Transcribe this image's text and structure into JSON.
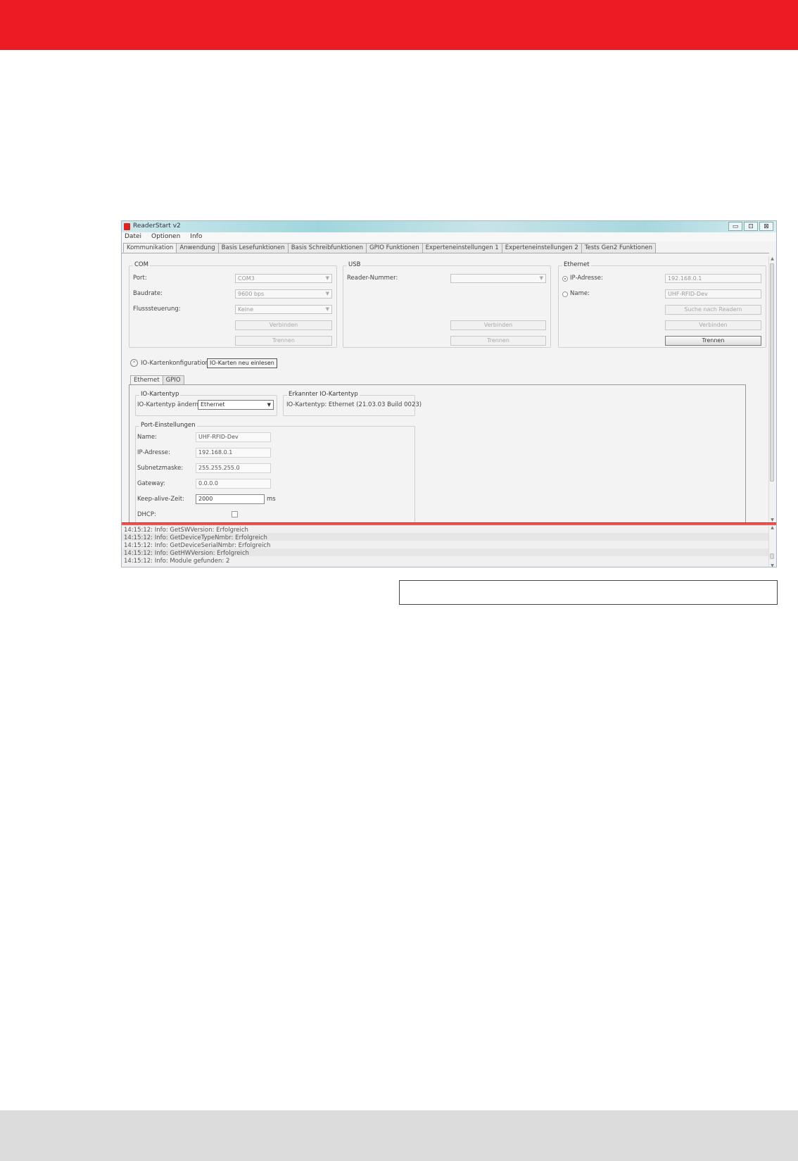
{
  "window": {
    "title": "ReaderStart v2",
    "min": "▭",
    "max": "⊡",
    "close": "⊠"
  },
  "menu": [
    "Datei",
    "Optionen",
    "Info"
  ],
  "tabs": [
    "Kommunikation",
    "Anwendung",
    "Basis Lesefunktionen",
    "Basis Schreibfunktionen",
    "GPIO Funktionen",
    "Experteneinstellungen 1",
    "Experteneinstellungen 2",
    "Tests Gen2 Funktionen"
  ],
  "com": {
    "title": "COM",
    "port_label": "Port:",
    "port_value": "COM3",
    "baud_label": "Baudrate:",
    "baud_value": "9600 bps",
    "flow_label": "Flusssteuerung:",
    "flow_value": "Keine",
    "connect": "Verbinden",
    "disconnect": "Trennen"
  },
  "usb": {
    "title": "USB",
    "reader_label": "Reader-Nummer:",
    "reader_value": "",
    "connect": "Verbinden",
    "disconnect": "Trennen"
  },
  "ethernet": {
    "title": "Ethernet",
    "ip_label": "IP-Adresse:",
    "ip_value": "192.168.0.1",
    "name_label": "Name:",
    "name_value": "UHF-RFID-Dev",
    "search": "Suche nach Readern",
    "connect": "Verbinden",
    "disconnect": "Trennen"
  },
  "io": {
    "collapse_label": "IO-Kartenkonfiguration",
    "button": "IO-Karten neu einlesen",
    "subtabs": [
      "Ethernet",
      "GPIO"
    ],
    "type_group": "IO-Kartentyp",
    "type_change_label": "IO-Kartentyp ändern:",
    "type_value": "Ethernet",
    "detected_group": "Erkannter IO-Kartentyp",
    "detected_text": "IO-Kartentyp: Ethernet (21.03.03 Build 0023)",
    "port_group": "Port-Einstellungen",
    "fields": [
      {
        "label": "Name:",
        "value": "UHF-RFID-Dev"
      },
      {
        "label": "IP-Adresse:",
        "value": "192.168.0.1"
      },
      {
        "label": "Subnetzmaske:",
        "value": "255.255.255.0"
      },
      {
        "label": "Gateway:",
        "value": "0.0.0.0"
      },
      {
        "label": "Keep-alive-Zeit:",
        "value": "2000"
      }
    ],
    "unit_ms": "ms",
    "dhcp_label": "DHCP:"
  },
  "log": [
    "14:15:12: Info: GetSWVersion: Erfolgreich",
    "14:15:12: Info: GetDeviceTypeNmbr: Erfolgreich",
    "14:15:12: Info: GetDeviceSerialNmbr: Erfolgreich",
    "14:15:12: Info: GetHWVersion: Erfolgreich",
    "14:15:12: Info: Module gefunden: 2"
  ],
  "colors": {
    "brand_red": "#ed1c24",
    "footer_gray": "#dcdcdc"
  }
}
